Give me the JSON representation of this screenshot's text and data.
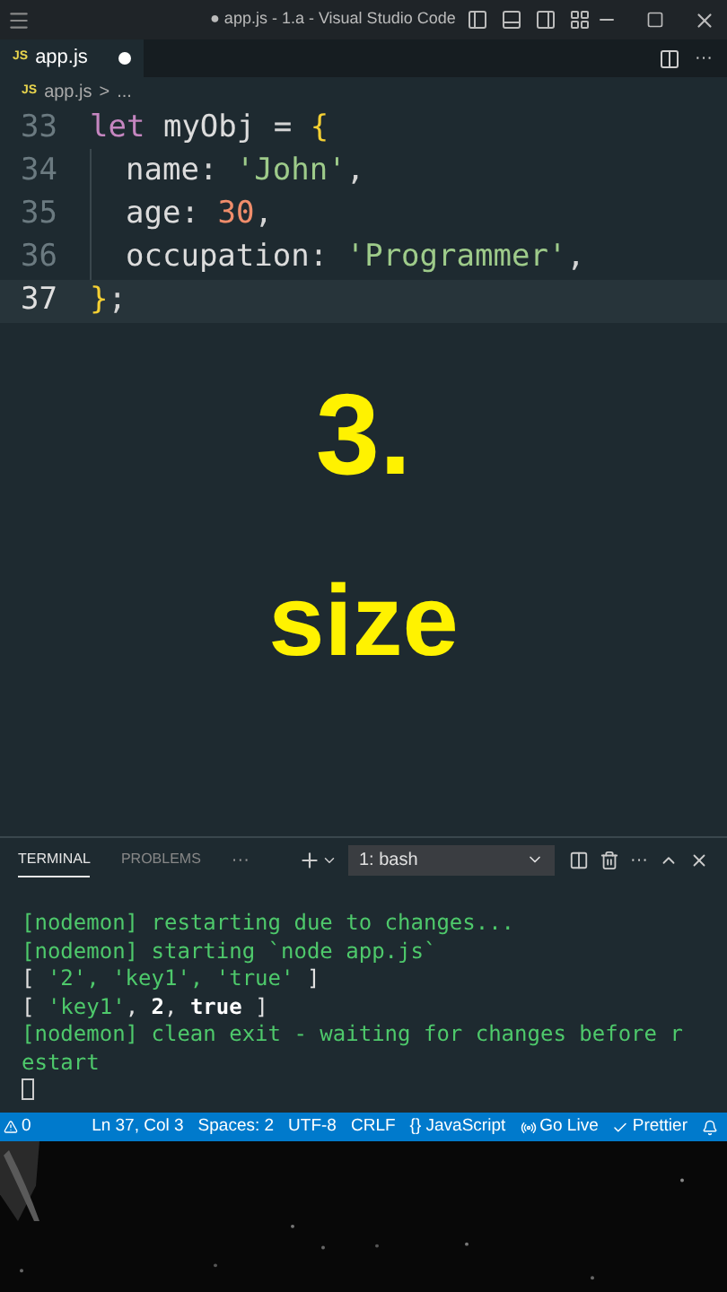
{
  "window": {
    "title": "● app.js - 1.a - Visual Studio Code"
  },
  "tabs": [
    {
      "label": "app.js",
      "icon": "JS",
      "selected": true,
      "modified": true
    }
  ],
  "breadcrumb": {
    "icon": "JS",
    "file": "app.js",
    "sep": ">",
    "rest": "..."
  },
  "editor_actions": {
    "more": "···"
  },
  "editor": {
    "lines": [
      {
        "number": "33",
        "indent": false,
        "tokens": [
          {
            "kind": "keyword",
            "text": "let "
          },
          {
            "kind": "plain",
            "text": "myObj "
          },
          {
            "kind": "punct",
            "text": "= "
          },
          {
            "kind": "bracket",
            "text": "{"
          }
        ]
      },
      {
        "number": "34",
        "indent": true,
        "tokens": [
          {
            "kind": "plain",
            "text": "name"
          },
          {
            "kind": "punct",
            "text": ": "
          },
          {
            "kind": "string",
            "text": "'John'"
          },
          {
            "kind": "punct",
            "text": ","
          }
        ]
      },
      {
        "number": "35",
        "indent": true,
        "tokens": [
          {
            "kind": "plain",
            "text": "age"
          },
          {
            "kind": "punct",
            "text": ": "
          },
          {
            "kind": "number",
            "text": "30"
          },
          {
            "kind": "punct",
            "text": ","
          }
        ]
      },
      {
        "number": "36",
        "indent": true,
        "tokens": [
          {
            "kind": "plain",
            "text": "occupation"
          },
          {
            "kind": "punct",
            "text": ": "
          },
          {
            "kind": "string",
            "text": "'Programmer'"
          },
          {
            "kind": "punct",
            "text": ","
          }
        ]
      },
      {
        "number": "37",
        "current": true,
        "indent": false,
        "tokens": [
          {
            "kind": "bracket",
            "text": "}"
          },
          {
            "kind": "punct",
            "text": ";"
          }
        ]
      }
    ]
  },
  "overlay": {
    "number": "3.",
    "word": "size"
  },
  "panel": {
    "tabs": [
      {
        "label": "TERMINAL",
        "selected": true
      },
      {
        "label": "PROBLEMS",
        "selected": false
      }
    ],
    "more": "···",
    "terminal_select": "1: bash",
    "lines": [
      [
        {
          "kind": "plain",
          "text": "[nodemon] restarting due to changes..."
        }
      ],
      [
        {
          "kind": "plain",
          "text": "[nodemon] starting `node app.js`"
        }
      ],
      [
        {
          "kind": "white",
          "text": "[ "
        },
        {
          "kind": "plain",
          "text": "'2', 'key1', 'true'"
        },
        {
          "kind": "white",
          "text": " ]"
        }
      ],
      [
        {
          "kind": "white",
          "text": "[ "
        },
        {
          "kind": "plain",
          "text": "'key1'"
        },
        {
          "kind": "white",
          "text": ", "
        },
        {
          "kind": "bold",
          "text": "2"
        },
        {
          "kind": "white",
          "text": ", "
        },
        {
          "kind": "bold",
          "text": "true"
        },
        {
          "kind": "white",
          "text": " ]"
        }
      ],
      [
        {
          "kind": "plain",
          "text": "[nodemon] clean exit - waiting for changes before r"
        }
      ],
      [
        {
          "kind": "plain",
          "text": "estart"
        }
      ]
    ]
  },
  "status_bar": {
    "warnings": "0",
    "items": [
      "Ln 37, Col 3",
      "Spaces: 2",
      "UTF-8",
      "CRLF",
      "{} JavaScript"
    ],
    "go_live": "Go Live",
    "prettier": "Prettier"
  }
}
